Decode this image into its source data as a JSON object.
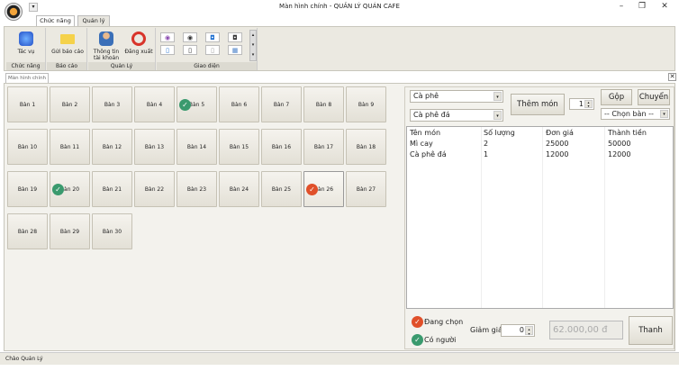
{
  "window": {
    "title": "Màn hình chính - QUẢN LÝ QUÁN CAFE"
  },
  "ribbon": {
    "tabs": [
      "Chức năng",
      "Quản lý"
    ],
    "groups": {
      "chuc_nang": {
        "label": "Chức năng",
        "button": "Tác vụ"
      },
      "bao_cao": {
        "label": "Báo cáo",
        "button": "Gửi báo cáo"
      },
      "quan_ly": {
        "label": "Quản Lý",
        "account": "Thông tin tài khoản",
        "logout": "Đăng xuất"
      },
      "giao_dien": {
        "label": "Giao diện"
      }
    }
  },
  "doc_tab": "Màn hình chính",
  "tables": [
    {
      "name": "Bàn 1",
      "status": "empty"
    },
    {
      "name": "Bàn 2",
      "status": "empty"
    },
    {
      "name": "Bàn 3",
      "status": "empty"
    },
    {
      "name": "Bàn 4",
      "status": "empty"
    },
    {
      "name": "Bàn 5",
      "status": "occupied"
    },
    {
      "name": "Bàn 6",
      "status": "empty"
    },
    {
      "name": "Bàn 7",
      "status": "empty"
    },
    {
      "name": "Bàn 8",
      "status": "empty"
    },
    {
      "name": "Bàn 9",
      "status": "empty"
    },
    {
      "name": "Bàn 10",
      "status": "empty"
    },
    {
      "name": "Bàn 11",
      "status": "empty"
    },
    {
      "name": "Bàn 12",
      "status": "empty"
    },
    {
      "name": "Bàn 13",
      "status": "empty"
    },
    {
      "name": "Bàn 14",
      "status": "empty"
    },
    {
      "name": "Bàn 15",
      "status": "empty"
    },
    {
      "name": "Bàn 16",
      "status": "empty"
    },
    {
      "name": "Bàn 17",
      "status": "empty"
    },
    {
      "name": "Bàn 18",
      "status": "empty"
    },
    {
      "name": "Bàn 19",
      "status": "empty"
    },
    {
      "name": "Bàn 20",
      "status": "occupied"
    },
    {
      "name": "Bàn 21",
      "status": "empty"
    },
    {
      "name": "Bàn 22",
      "status": "empty"
    },
    {
      "name": "Bàn 23",
      "status": "empty"
    },
    {
      "name": "Bàn 24",
      "status": "empty"
    },
    {
      "name": "Bàn 25",
      "status": "empty"
    },
    {
      "name": "Bàn 26",
      "status": "selected"
    },
    {
      "name": "Bàn 27",
      "status": "empty"
    },
    {
      "name": "Bàn 28",
      "status": "empty"
    },
    {
      "name": "Bàn 29",
      "status": "empty"
    },
    {
      "name": "Bàn 30",
      "status": "empty"
    }
  ],
  "order": {
    "category": "Cà phê",
    "food": "Cà phê đá",
    "add_button": "Thêm món",
    "quantity": "1",
    "merge_button": "Gộp",
    "move_button": "Chuyển",
    "target_table": "-- Chọn bàn --",
    "columns": [
      "Tên món",
      "Số lượng",
      "Đơn giá",
      "Thành tiền"
    ],
    "rows": [
      [
        "Mì cay",
        "2",
        "25000",
        "50000"
      ],
      [
        "Cà phê đá",
        "1",
        "12000",
        "12000"
      ]
    ]
  },
  "legend": {
    "selected": "Đang chọn",
    "occupied": "Có người"
  },
  "payment": {
    "discount_label": "Giảm giá",
    "discount": "0",
    "total": "62.000,00 đ",
    "pay_button": "Thanh toán"
  },
  "status_bar": "Chào Quản Lý",
  "colors": {
    "occupied": "#3a9a6e",
    "selected": "#e0502a"
  }
}
